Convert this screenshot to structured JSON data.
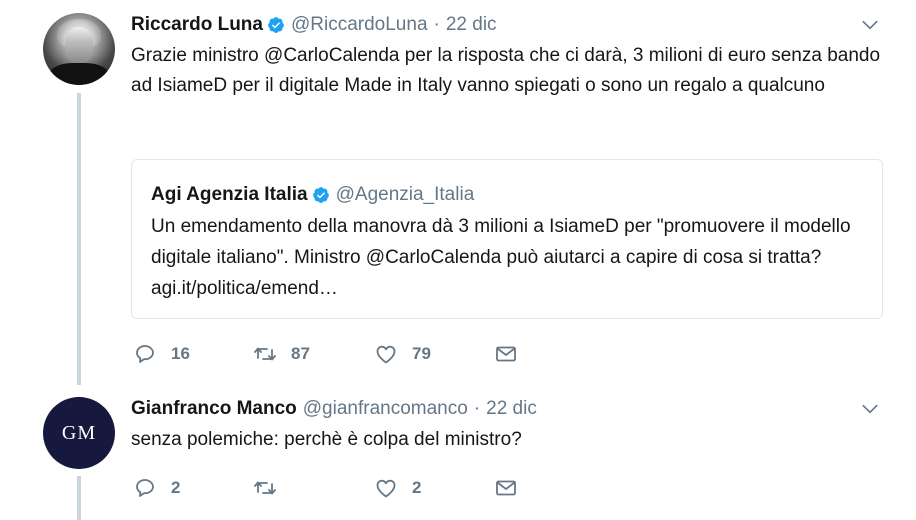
{
  "tweet1": {
    "name": "Riccardo Luna",
    "handle": "@RiccardoLuna",
    "separator": "·",
    "date": "22 dic",
    "text": "Grazie ministro @CarloCalenda per la risposta che ci darà, 3 milioni di euro senza bando ad IsiameD per il digitale Made in Italy vanno spiegati o sono un regalo a qualcuno",
    "quote": {
      "name": "Agi Agenzia Italia",
      "handle": "@Agenzia_Italia",
      "text": "Un emendamento della manovra dà 3 milioni a IsiameD per \"promuovere il modello digitale italiano\". Ministro @CarloCalenda può aiutarci a capire di cosa si tratta? agi.it/politica/emend…"
    },
    "replies": "16",
    "retweets": "87",
    "likes": "79"
  },
  "tweet2": {
    "avatar_initials": "GM",
    "name": "Gianfranco Manco",
    "handle": "@gianfrancomanco",
    "separator": "·",
    "date": "22 dic",
    "text": "senza polemiche: perchè è colpa del ministro?",
    "replies": "2",
    "retweets": "",
    "likes": "2"
  },
  "colors": {
    "verified": "#1da1f2",
    "muted": "#657786",
    "thread_line": "#ccd6dd",
    "avatar_gm_bg": "#16193d"
  },
  "icons": [
    "verified-badge-icon",
    "chevron-down-icon",
    "reply-icon",
    "retweet-icon",
    "like-icon",
    "direct-message-icon"
  ]
}
